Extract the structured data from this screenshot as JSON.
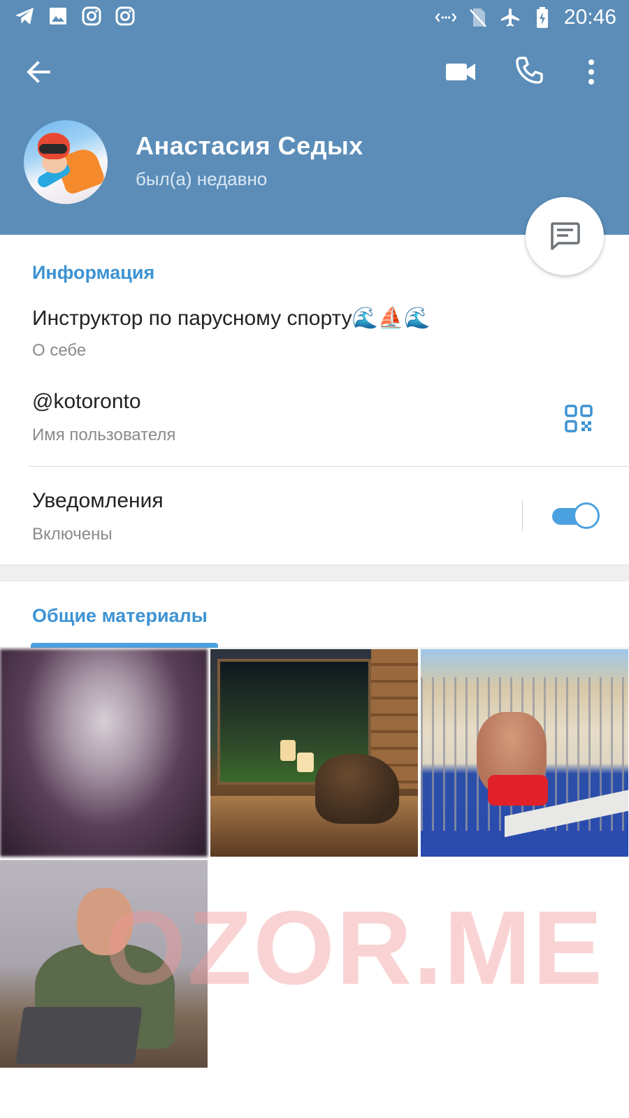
{
  "status_bar": {
    "time": "20:46",
    "left_icons": [
      "telegram-icon",
      "gallery-icon",
      "instagram-icon",
      "instagram-icon"
    ],
    "right_icons": [
      "data-saver-icon",
      "no-sim-icon",
      "airplane-icon",
      "battery-charging-icon"
    ]
  },
  "toolbar": {
    "back": "back-arrow-icon",
    "video": "video-call-icon",
    "call": "phone-icon",
    "more": "more-vert-icon"
  },
  "profile": {
    "name": "Анастасия Седых",
    "status": "был(а) недавно"
  },
  "info": {
    "section_title": "Информация",
    "bio": "Инструктор по парусному спорту🌊⛵🌊",
    "bio_label": "О себе",
    "username": "@kotoronto",
    "username_label": "Имя пользователя",
    "notifications": "Уведомления",
    "notifications_state": "Включены",
    "notifications_enabled": true
  },
  "shared": {
    "tab_title": "Общие материалы",
    "media_count": 4
  },
  "watermark": "OZOR.ME",
  "colors": {
    "header": "#5b8db8",
    "accent": "#3d93d3",
    "toggle": "#4ba1df"
  }
}
